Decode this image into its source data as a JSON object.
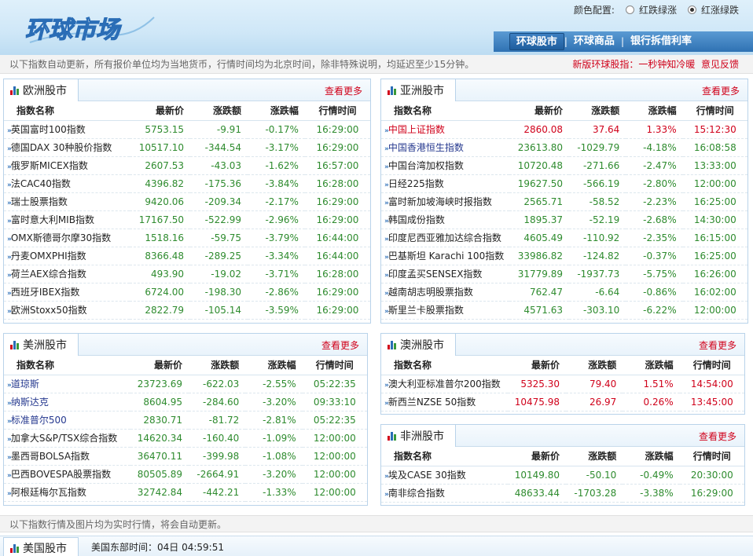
{
  "header": {
    "logo_text": "环球市场",
    "color_config_label": "颜色配置:",
    "option_a": "红跌绿涨",
    "option_b": "红涨绿跌",
    "nav": [
      "环球股市",
      "环球商品",
      "银行拆借利率"
    ]
  },
  "notice": {
    "text": "以下指数自动更新，所有报价单位均为当地货币，行情时间均为北京时间，除非特殊说明，均延迟至少15分钟。",
    "right_text": "新版环球股指：一秒钟知冷暖",
    "feedback": "意见反馈"
  },
  "columns": [
    "指数名称",
    "最新价",
    "涨跌额",
    "涨跌幅",
    "行情时间"
  ],
  "more_label": "查看更多",
  "colors": {
    "up": "#d0021b",
    "down": "#2e8b2e"
  },
  "europe": {
    "title": "欧洲股市",
    "rows": [
      [
        "英国富时100指数",
        "5753.15",
        "-9.91",
        "-0.17%",
        "16:29:00"
      ],
      [
        "德国DAX 30种股价指数",
        "10517.10",
        "-344.54",
        "-3.17%",
        "16:29:00"
      ],
      [
        "俄罗斯MICEX指数",
        "2607.53",
        "-43.03",
        "-1.62%",
        "16:57:00"
      ],
      [
        "法CAC40指数",
        "4396.82",
        "-175.36",
        "-3.84%",
        "16:28:00"
      ],
      [
        "瑞士股票指数",
        "9420.06",
        "-209.34",
        "-2.17%",
        "16:29:00"
      ],
      [
        "富时意大利MIB指数",
        "17167.50",
        "-522.99",
        "-2.96%",
        "16:29:00"
      ],
      [
        "OMX斯德哥尔摩30指数",
        "1518.16",
        "-59.75",
        "-3.79%",
        "16:44:00"
      ],
      [
        "丹麦OMXPHI指数",
        "8366.48",
        "-289.25",
        "-3.34%",
        "16:44:00"
      ],
      [
        "荷兰AEX综合指数",
        "493.90",
        "-19.02",
        "-3.71%",
        "16:28:00"
      ],
      [
        "西班牙IBEX指数",
        "6724.00",
        "-198.30",
        "-2.86%",
        "16:29:00"
      ],
      [
        "欧洲Stoxx50指数",
        "2822.79",
        "-105.14",
        "-3.59%",
        "16:29:00"
      ]
    ]
  },
  "asia": {
    "title": "亚洲股市",
    "rows": [
      [
        "中国上证指数",
        "2860.08",
        "37.64",
        "1.33%",
        "15:12:30"
      ],
      [
        "中国香港恒生指数",
        "23613.80",
        "-1029.79",
        "-4.18%",
        "16:08:58"
      ],
      [
        "中国台湾加权指数",
        "10720.48",
        "-271.66",
        "-2.47%",
        "13:33:00"
      ],
      [
        "日经225指数",
        "19627.50",
        "-566.19",
        "-2.80%",
        "12:00:00"
      ],
      [
        "富时新加坡海峡时报指数",
        "2565.71",
        "-58.52",
        "-2.23%",
        "16:25:00"
      ],
      [
        "韩国成份指数",
        "1895.37",
        "-52.19",
        "-2.68%",
        "14:30:00"
      ],
      [
        "印度尼西亚雅加达综合指数",
        "4605.49",
        "-110.92",
        "-2.35%",
        "16:15:00"
      ],
      [
        "巴基斯坦 Karachi 100指数",
        "33986.82",
        "-124.82",
        "-0.37%",
        "16:25:00"
      ],
      [
        "印度孟买SENSEX指数",
        "31779.89",
        "-1937.73",
        "-5.75%",
        "16:26:00"
      ],
      [
        "越南胡志明股票指数",
        "762.47",
        "-6.64",
        "-0.86%",
        "16:02:00"
      ],
      [
        "斯里兰卡股票指数",
        "4571.63",
        "-303.10",
        "-6.22%",
        "12:00:00"
      ]
    ]
  },
  "america": {
    "title": "美洲股市",
    "rows": [
      [
        "道琼斯",
        "23723.69",
        "-622.03",
        "-2.55%",
        "05:22:35"
      ],
      [
        "纳斯达克",
        "8604.95",
        "-284.60",
        "-3.20%",
        "09:33:10"
      ],
      [
        "标准普尔500",
        "2830.71",
        "-81.72",
        "-2.81%",
        "05:22:35"
      ],
      [
        "加拿大S&P/TSX综合指数",
        "14620.34",
        "-160.40",
        "-1.09%",
        "12:00:00"
      ],
      [
        "墨西哥BOLSA指数",
        "36470.11",
        "-399.98",
        "-1.08%",
        "12:00:00"
      ],
      [
        "巴西BOVESPA股票指数",
        "80505.89",
        "-2664.91",
        "-3.20%",
        "12:00:00"
      ],
      [
        "阿根廷梅尔瓦指数",
        "32742.84",
        "-442.21",
        "-1.33%",
        "12:00:00"
      ]
    ]
  },
  "oceania": {
    "title": "澳洲股市",
    "rows": [
      [
        "澳大利亚标准普尔200指数",
        "5325.30",
        "79.40",
        "1.51%",
        "14:54:00"
      ],
      [
        "新西兰NZSE 50指数",
        "10475.98",
        "26.97",
        "0.26%",
        "13:45:00"
      ]
    ]
  },
  "africa": {
    "title": "非洲股市",
    "rows": [
      [
        "埃及CASE 30指数",
        "10149.80",
        "-50.10",
        "-0.49%",
        "20:30:00"
      ],
      [
        "南非综合指数",
        "48633.44",
        "-1703.28",
        "-3.38%",
        "16:29:00"
      ]
    ]
  },
  "footer": {
    "note": "以下指数行情及图片均为实时行情，将会自动更新。",
    "us_title": "美国股市",
    "us_clock": "美国东部时间：04日 04:59:51"
  }
}
